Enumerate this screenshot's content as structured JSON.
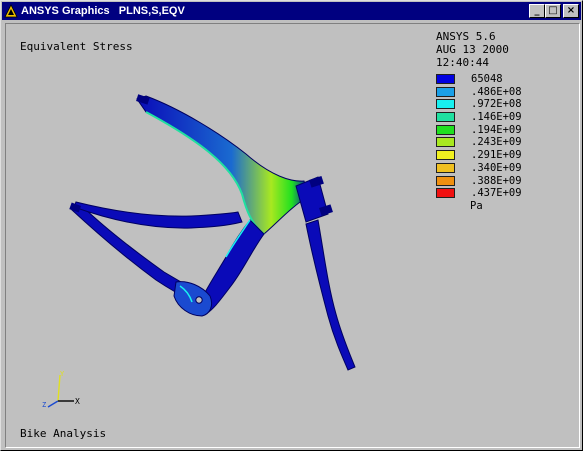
{
  "window": {
    "title": "ANSYS Graphics   PLNS,S,EQV",
    "buttons": {
      "minimize": "_",
      "maximize": "□",
      "close": "×"
    }
  },
  "plot": {
    "title": "Equivalent Stress",
    "footer": "Bike Analysis",
    "version": "ANSYS 5.6",
    "date": "AUG 13 2000",
    "time": "12:40:44"
  },
  "legend": {
    "items": [
      {
        "label": "65048",
        "color": "#0000e0"
      },
      {
        "label": ".486E+08",
        "color": "#1aa0e8"
      },
      {
        "label": ".972E+08",
        "color": "#18f0f0"
      },
      {
        "label": ".146E+09",
        "color": "#20e0a0"
      },
      {
        "label": ".194E+09",
        "color": "#20e020"
      },
      {
        "label": ".243E+09",
        "color": "#a8e820"
      },
      {
        "label": ".291E+09",
        "color": "#f0f020"
      },
      {
        "label": ".340E+09",
        "color": "#f0c020"
      },
      {
        "label": ".388E+09",
        "color": "#f09010"
      },
      {
        "label": ".437E+09",
        "color": "#f01010"
      }
    ],
    "unit": "Pa"
  },
  "triad": {
    "x_label": "X",
    "y_label": "Y",
    "z_label": "Z"
  },
  "colors": {
    "background": "#c0c0c0",
    "titlebar": "#000080",
    "frame_blue": "#0a0ab8",
    "frame_dark": "#000060"
  }
}
